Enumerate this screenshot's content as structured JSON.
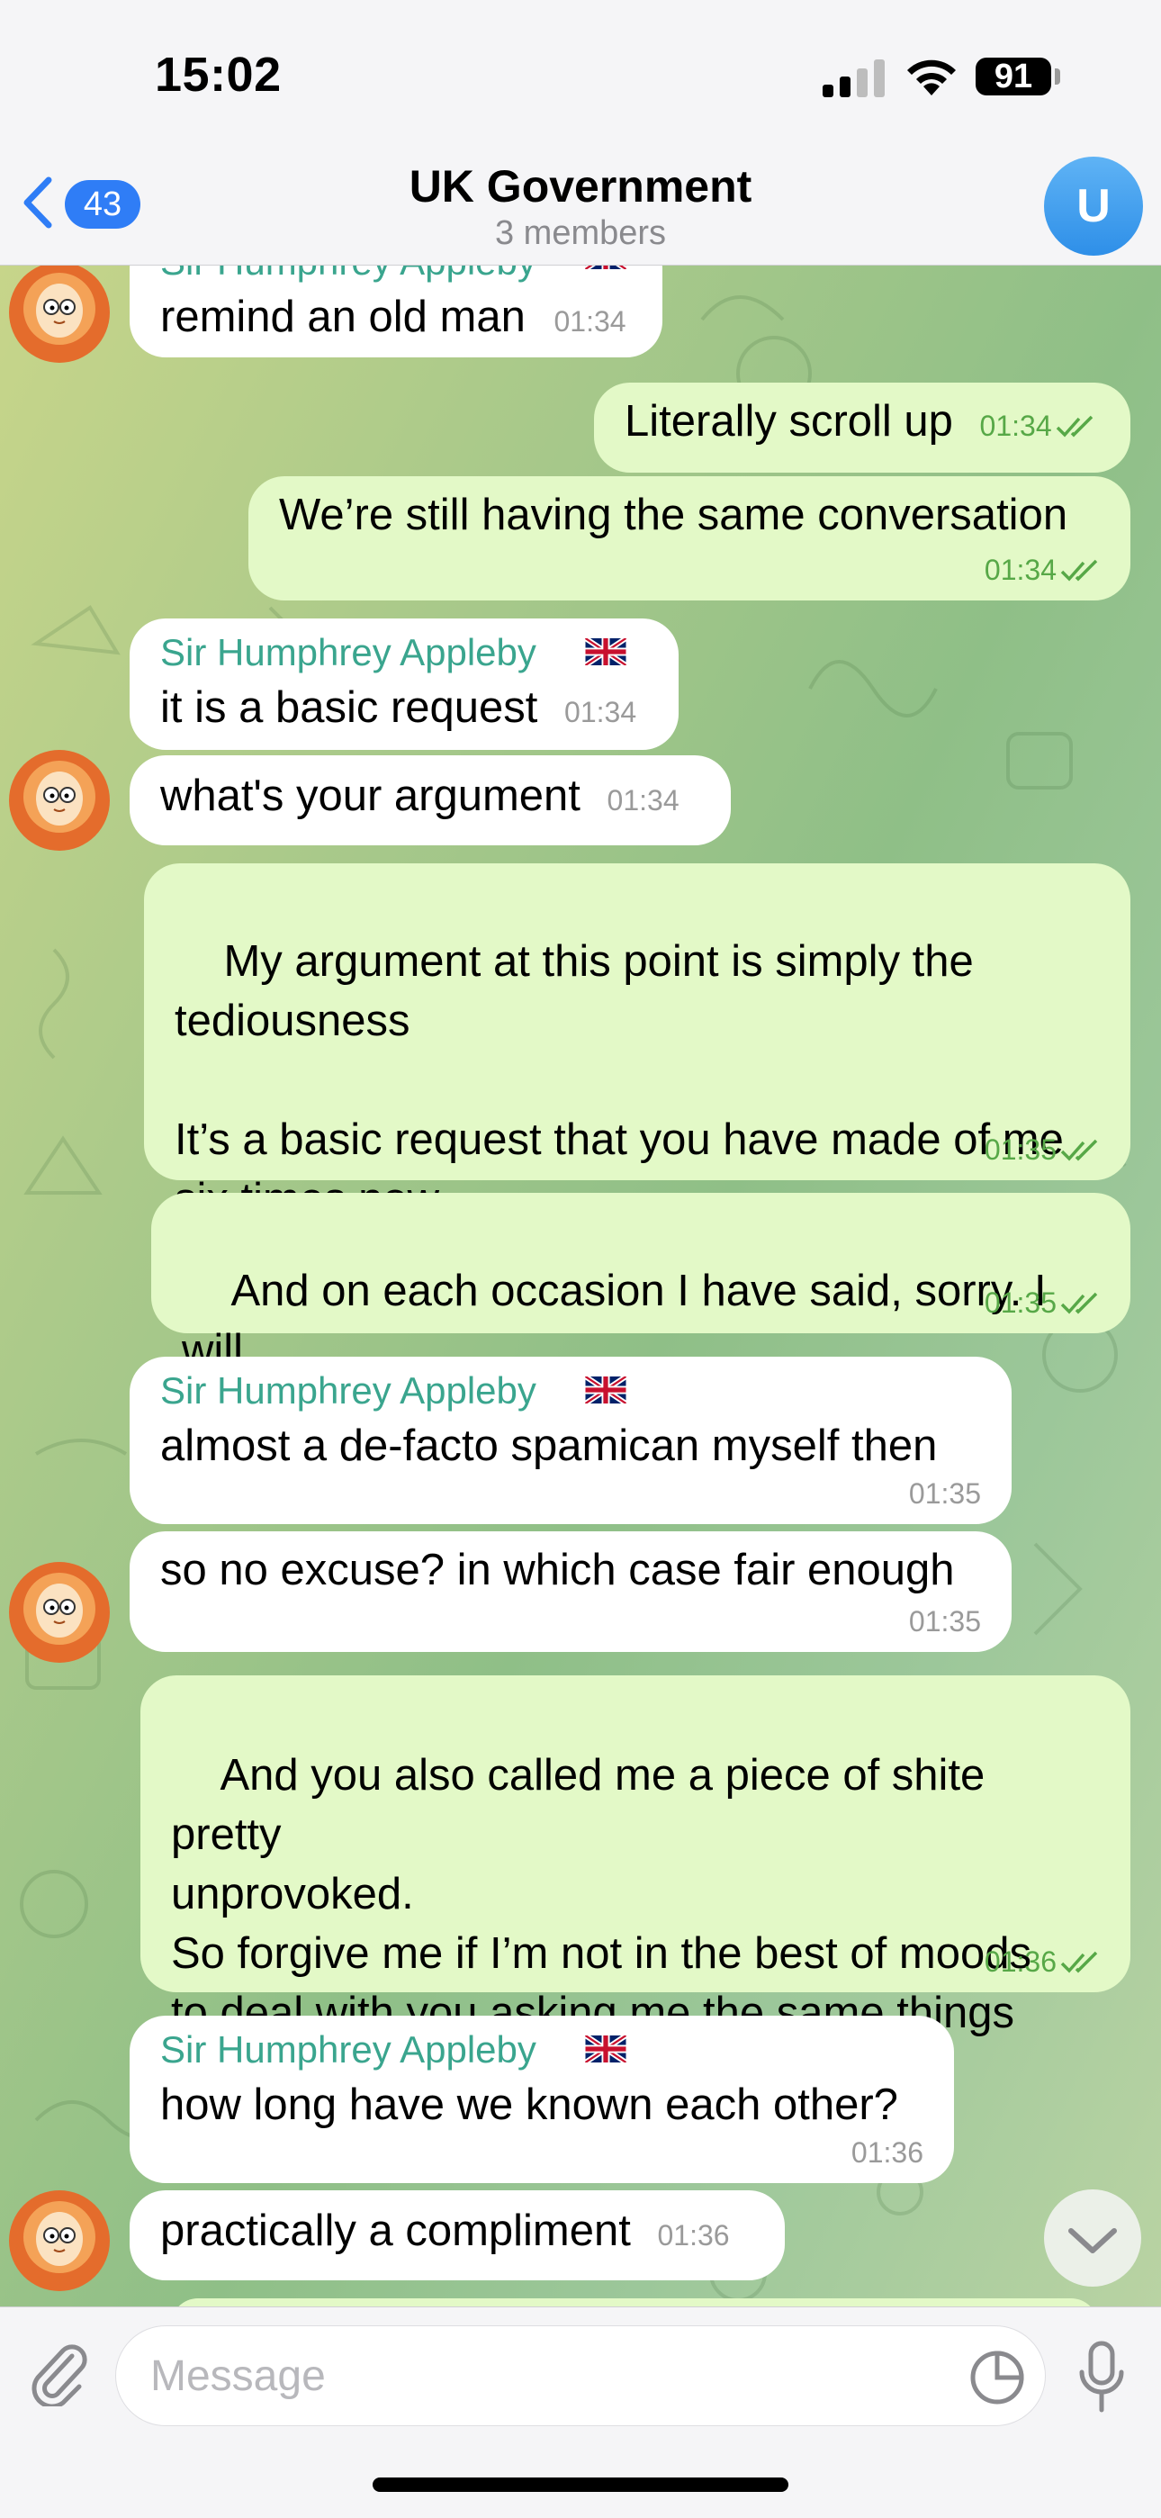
{
  "status_bar": {
    "time": "15:02",
    "battery": "91"
  },
  "header": {
    "back_count": "43",
    "title": "UK Government",
    "subtitle": "3 members",
    "avatar_initial": "U"
  },
  "messages": [
    {
      "dir": "in",
      "sender": "Sir Humphrey Appleby",
      "text": "remind an old man",
      "time": "01:34"
    },
    {
      "dir": "out",
      "text": "Literally scroll up",
      "time": "01:34",
      "read": true
    },
    {
      "dir": "out",
      "text": "We’re still having the same conversation",
      "time": "01:34",
      "read": true
    },
    {
      "dir": "in",
      "sender": "Sir Humphrey Appleby",
      "text": "it is a basic request",
      "time": "01:34"
    },
    {
      "dir": "in",
      "text": "what's your argument",
      "time": "01:34"
    },
    {
      "dir": "out",
      "text": "My argument at this point is simply the\ntediousness\n\nIt’s a basic request that you have made of me\nsix times now",
      "time": "01:35",
      "read": true
    },
    {
      "dir": "out",
      "text": "And on each occasion I have said, sorry. I will\npost to cabinet first next time",
      "time": "01:35",
      "read": true
    },
    {
      "dir": "in",
      "sender": "Sir Humphrey Appleby",
      "text": "almost a de-facto spamican myself then",
      "time": "01:35"
    },
    {
      "dir": "in",
      "text": "so no excuse? in which case fair enough",
      "time": "01:35"
    },
    {
      "dir": "out",
      "text": "And you also called me a piece of shite pretty\nunprovoked.\nSo forgive me if I’m not in the best of moods\nto deal with you asking me the same things\nover and over again",
      "time": "01:36",
      "read": true
    },
    {
      "dir": "in",
      "sender": "Sir Humphrey Appleby",
      "text": "how long have we known each other?",
      "time": "01:36"
    },
    {
      "dir": "in",
      "text": "practically a compliment",
      "time": "01:36"
    }
  ],
  "input": {
    "placeholder": "Message"
  },
  "icons": {
    "attach": "paperclip-icon",
    "sticker": "sticker-icon",
    "mic": "microphone-icon",
    "scroll_down": "chevron-down-icon",
    "back": "chevron-left-icon"
  },
  "colors": {
    "accent": "#2f7df6",
    "sender_name": "#3aa58e",
    "outgoing_bubble": "#e3f9c7",
    "incoming_bubble": "#ffffff",
    "read_ticks": "#57a847"
  }
}
